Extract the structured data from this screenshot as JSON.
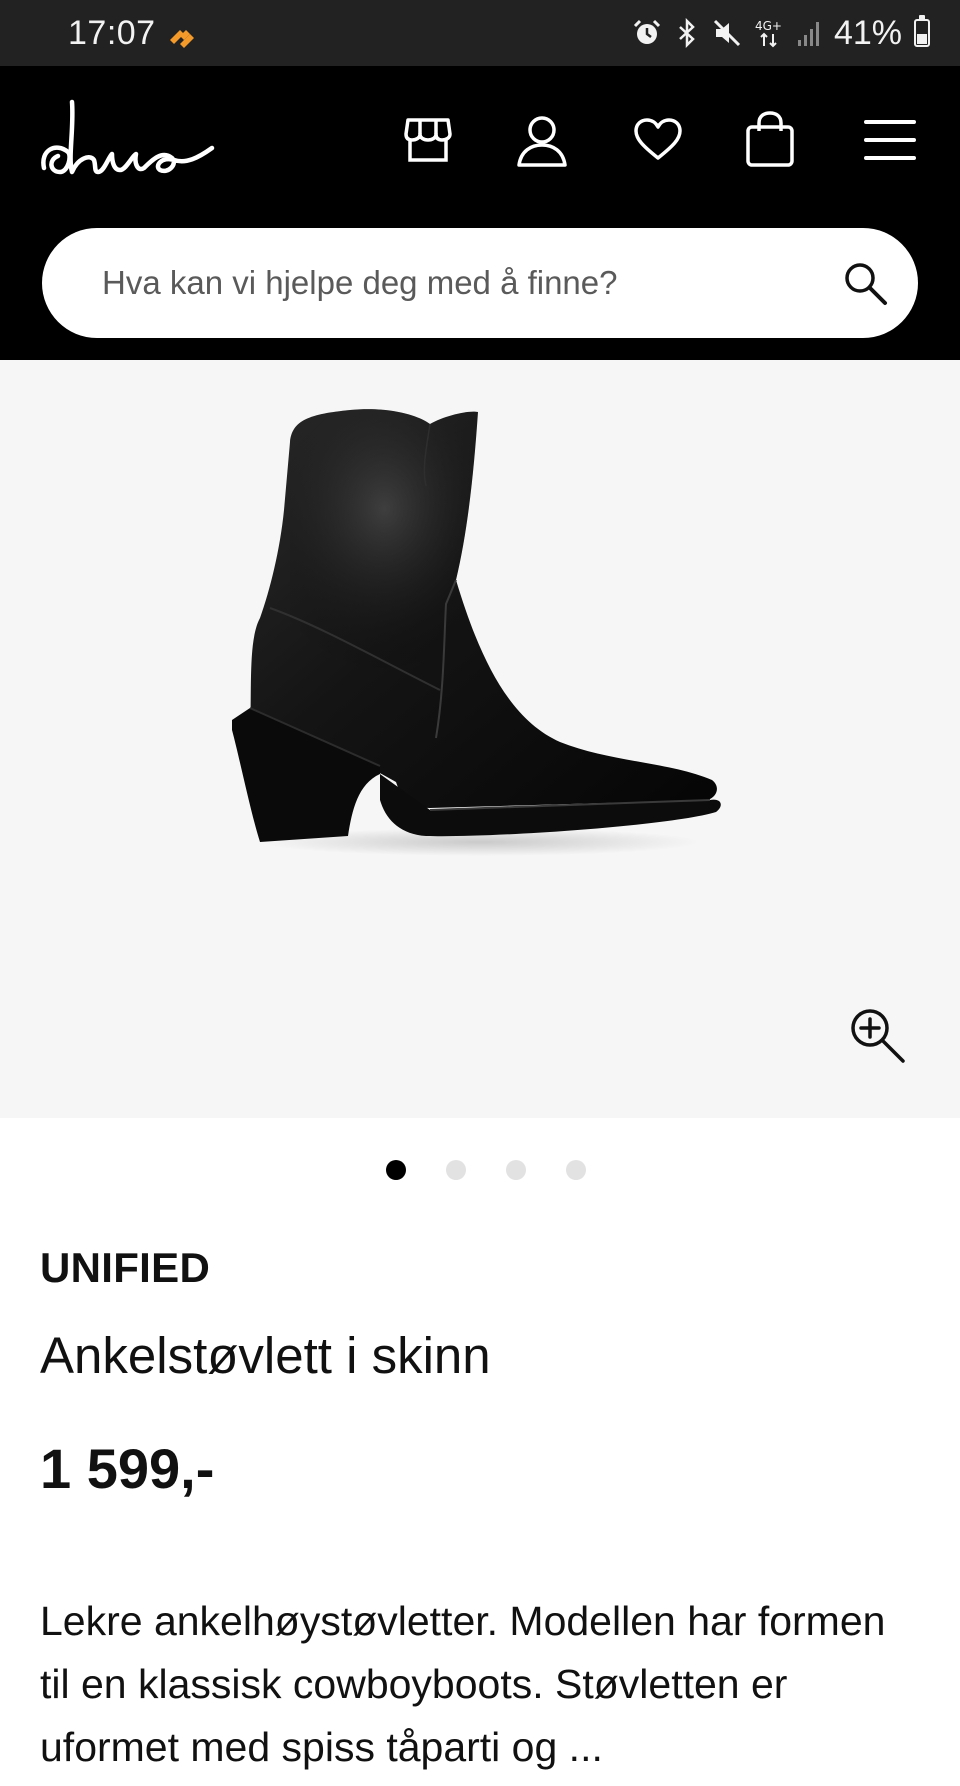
{
  "status_bar": {
    "time": "17:07",
    "battery_percent": "41%",
    "network": "4G+",
    "icons": [
      "alarm-icon",
      "bluetooth-icon",
      "mute-icon",
      "network-4g-icon",
      "signal-icon",
      "battery-icon"
    ],
    "app_icon": "app-notification-icon",
    "app_icon_color": "#f39a2b"
  },
  "header": {
    "logo_text": "dna",
    "icons": [
      "store-icon",
      "account-icon",
      "heart-icon",
      "shopping-bag-icon",
      "menu-icon"
    ],
    "background": "#000000"
  },
  "search": {
    "placeholder": "Hva kan vi hjelpe deg med å finne?",
    "value": ""
  },
  "gallery": {
    "image_alt": "black-leather-ankle-boot",
    "image_count": 4,
    "active_index": 1,
    "zoom_icon": "zoom-in-icon"
  },
  "product": {
    "brand": "UNIFIED",
    "name": "Ankelstøvlett i skinn",
    "price": "1 599,-",
    "description": "Lekre ankelhøystøvletter. Modellen har formen til en klassisk cowboyboots. Støvletten er uformet med spiss tåparti og ..."
  }
}
